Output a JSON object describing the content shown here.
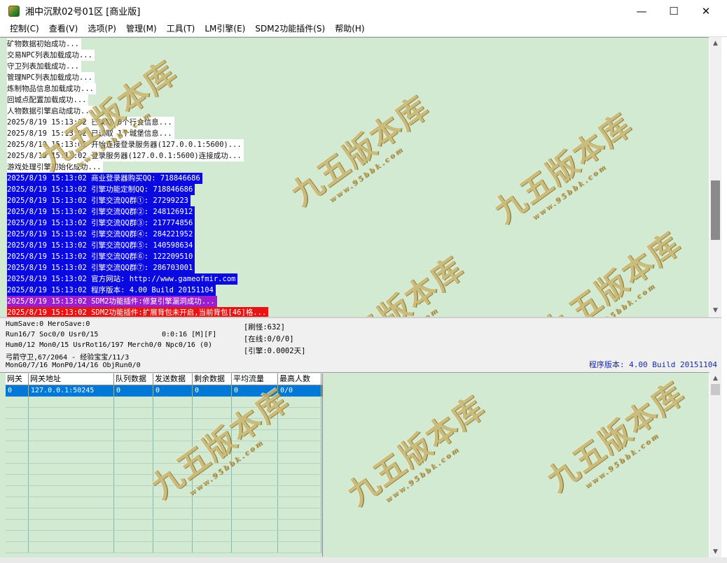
{
  "window": {
    "title": "湘中沉默02号01区 [商业版]",
    "minimize": "—",
    "maximize": "☐",
    "close": "✕"
  },
  "menu": [
    "控制(C)",
    "查看(V)",
    "选项(P)",
    "管理(M)",
    "工具(T)",
    "LM引擎(E)",
    "SDM2功能插件(S)",
    "帮助(H)"
  ],
  "log": [
    {
      "text": "矿物数据初始成功...",
      "style": "white"
    },
    {
      "text": "交易NPC列表加载成功...",
      "style": "white"
    },
    {
      "text": "守卫列表加载成功...",
      "style": "white"
    },
    {
      "text": "管理NPC列表加载成功...",
      "style": "white"
    },
    {
      "text": "炼制物品信息加载成功...",
      "style": "white"
    },
    {
      "text": "回城点配置加载成功...",
      "style": "white"
    },
    {
      "text": "人物数据引擎启动成功...",
      "style": "white"
    },
    {
      "text": "2025/8/19 15:13:02 已读取 0个行会信息...",
      "style": "white"
    },
    {
      "text": "2025/8/19 15:13:02 已读取 1个城堡信息...",
      "style": "white"
    },
    {
      "text": "2025/8/19 15:13:02 开始连接登录服务器(127.0.0.1:5600)...",
      "style": "white"
    },
    {
      "text": "2025/8/19 15:13:02 登录服务器(127.0.0.1:5600)连接成功...",
      "style": "white"
    },
    {
      "text": "游戏处理引擎初始化成功...",
      "style": "white"
    },
    {
      "text": "2025/8/19 15:13:02 商业登录器购买QQ: 718846686",
      "style": "blue"
    },
    {
      "text": "2025/8/19 15:13:02 引擎功能定制QQ: 718846686",
      "style": "blue"
    },
    {
      "text": "2025/8/19 15:13:02 引擎交流QQ群①: 27299223",
      "style": "blue"
    },
    {
      "text": "2025/8/19 15:13:02 引擎交流QQ群②: 248126912",
      "style": "blue"
    },
    {
      "text": "2025/8/19 15:13:02 引擎交流QQ群③: 217774856",
      "style": "blue"
    },
    {
      "text": "2025/8/19 15:13:02 引擎交流QQ群④: 284221952",
      "style": "blue"
    },
    {
      "text": "2025/8/19 15:13:02 引擎交流QQ群⑤: 140598634",
      "style": "blue"
    },
    {
      "text": "2025/8/19 15:13:02 引擎交流QQ群⑥: 122209510",
      "style": "blue"
    },
    {
      "text": "2025/8/19 15:13:02 引擎交流QQ群⑦: 286703001",
      "style": "blue"
    },
    {
      "text": "2025/8/19 15:13:02 官方网站: http://www.gameofmir.com",
      "style": "blue"
    },
    {
      "text": "2025/8/19 15:13:02 程序版本: 4.00 Build 20151104",
      "style": "blue"
    },
    {
      "text": "2025/8/19 15:13:02 SDM2功能插件:修复引擎漏洞成功...",
      "style": "purple"
    },
    {
      "text": "2025/8/19 15:13:02 SDM2功能插件:扩展背包未开启,当前背包[46]格...",
      "style": "red"
    }
  ],
  "status": {
    "line1": "HumSave:0 HeroSave:0",
    "line2a": "Run16/7 Soc0/0 Usr0/15",
    "line2b": "0:0:16 [M][F]",
    "line3": "Hum0/12 Mon0/15 UsrRot16/197 Merch0/0 Npc0/16 (0)",
    "line4": "弓箭守卫,67/2064 - 经验宝宝/11/3",
    "line5": "MonG0/7/16 MonP0/14/16 ObjRun0/0",
    "refresh": "[刷怪:632]",
    "online": "[在线:0/0/0]",
    "engine": "[引擎:0.0002天]",
    "version": "程序版本: 4.00 Build 20151104"
  },
  "grid": {
    "headers": [
      "网关",
      "网关地址",
      "队列数据",
      "发送数据",
      "剩余数据",
      "平均流量",
      "最高人数"
    ],
    "rows": [
      [
        "0",
        "127.0.0.1:50245",
        "0",
        "0",
        "0",
        "0",
        "0/0"
      ]
    ]
  },
  "watermark": {
    "text": "九五版本库",
    "url": "www.95bbk.com"
  }
}
